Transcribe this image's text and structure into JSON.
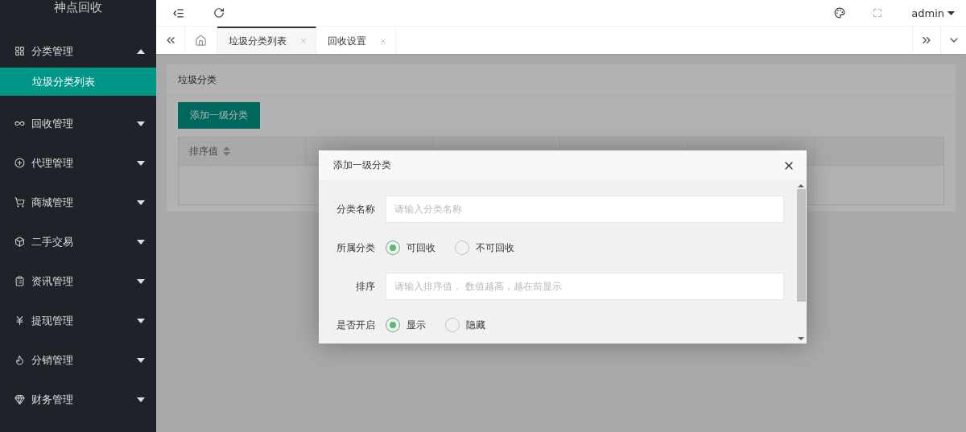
{
  "sidebar": {
    "logo": "神点回收",
    "items": [
      {
        "label": "分类管理",
        "expanded": true,
        "children": [
          {
            "label": "垃圾分类列表",
            "selected": true
          }
        ]
      },
      {
        "label": "回收管理",
        "expanded": false
      },
      {
        "label": "代理管理",
        "expanded": false
      },
      {
        "label": "商城管理",
        "expanded": false
      },
      {
        "label": "二手交易",
        "expanded": false
      },
      {
        "label": "资讯管理",
        "expanded": false
      },
      {
        "label": "提现管理",
        "expanded": false
      },
      {
        "label": "分销管理",
        "expanded": false
      },
      {
        "label": "财务管理",
        "expanded": false
      }
    ]
  },
  "header": {
    "user": "admin"
  },
  "tabs": [
    {
      "label": "垃圾分类列表",
      "selected": true
    },
    {
      "label": "回收设置",
      "selected": false
    }
  ],
  "card": {
    "title": "垃圾分类",
    "add_button": "添加一级分类",
    "table": {
      "columns": [
        "排序值"
      ]
    }
  },
  "dialog": {
    "title": "添加一级分类",
    "fields": [
      {
        "kind": "input",
        "label": "分类名称",
        "placeholder": "请输入分类名称"
      },
      {
        "kind": "radio",
        "label": "所属分类",
        "options": [
          {
            "label": "可回收",
            "selected": true
          },
          {
            "label": "不可回收",
            "selected": false
          }
        ]
      },
      {
        "kind": "input",
        "label": "排序",
        "placeholder": "请输入排序值， 数值越高，越在前显示"
      },
      {
        "kind": "radio",
        "label": "是否开启",
        "options": [
          {
            "label": "显示",
            "selected": true
          },
          {
            "label": "隐藏",
            "selected": false
          }
        ]
      }
    ]
  }
}
